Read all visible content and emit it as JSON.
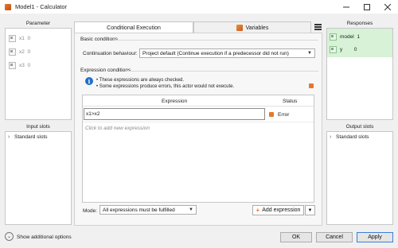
{
  "window": {
    "title": "Model1 - Calculator"
  },
  "parameter_panel": {
    "header": "Parameter",
    "items": [
      {
        "name": "x1",
        "value": "0"
      },
      {
        "name": "x2",
        "value": "0"
      },
      {
        "name": "x3",
        "value": "0"
      }
    ]
  },
  "input_slots": {
    "header": "Input slots",
    "items": [
      "Standard slots"
    ]
  },
  "output_slots": {
    "header": "Output slots",
    "items": [
      "Standard slots"
    ]
  },
  "responses": {
    "header": "Responses",
    "items": [
      {
        "name": "model",
        "value": "1"
      },
      {
        "name": "y",
        "value": "0"
      }
    ]
  },
  "tabs": [
    {
      "label": "Conditional Execution",
      "active": true
    },
    {
      "label": "Variables",
      "active": false
    }
  ],
  "basic_conditions": {
    "title": "Basic conditions",
    "continuation_label": "Continuation behaviour:",
    "continuation_value": "Project default (Continue execution if a predecessor did not run)"
  },
  "expression_conditions": {
    "title": "Expression conditions",
    "info_lines": [
      "• These expressions are always checked.",
      "• Some expressions produce errors, this actor would not execute."
    ],
    "table": {
      "col_expression": "Expression",
      "col_status": "Status",
      "rows": [
        {
          "expression": "x1>x2",
          "status": "Error"
        }
      ],
      "placeholder": "Click to add new expression"
    },
    "mode_label": "Mode:",
    "mode_value": "All expressions must be fulfilled",
    "add_expression_label": "Add expression"
  },
  "footer": {
    "show_additional": "Show additional options",
    "ok": "OK",
    "cancel": "Cancel",
    "apply": "Apply"
  },
  "colors": {
    "response_bg": "#d7f2d7",
    "accent_blue": "#1f6fc9",
    "error_orange": "#e8762a"
  }
}
